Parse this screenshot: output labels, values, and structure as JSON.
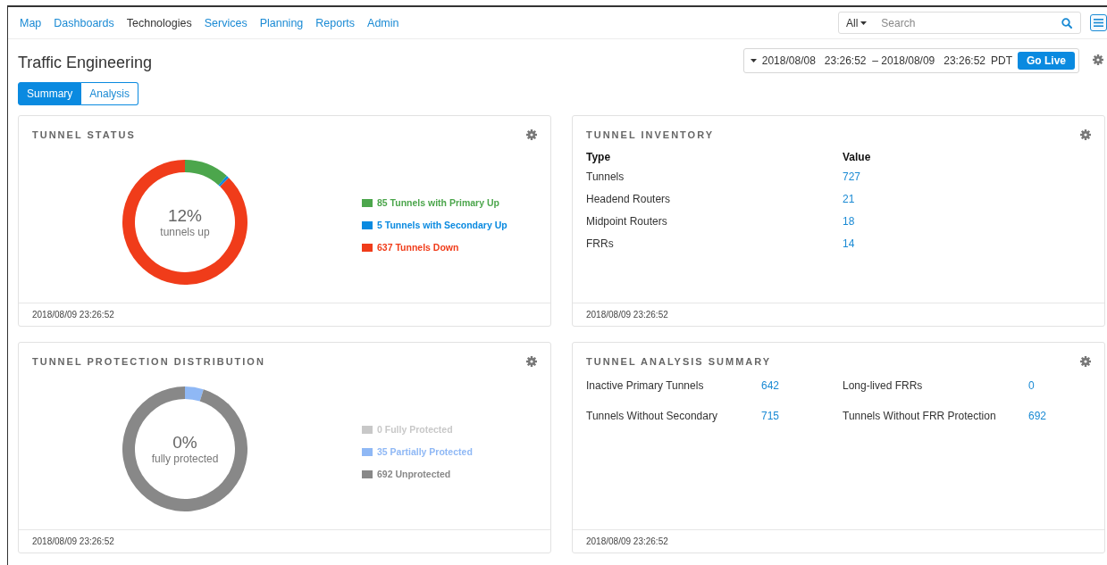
{
  "nav": {
    "items": [
      {
        "label": "Map",
        "selected": false
      },
      {
        "label": "Dashboards",
        "selected": false
      },
      {
        "label": "Technologies",
        "selected": true
      },
      {
        "label": "Services",
        "selected": false
      },
      {
        "label": "Planning",
        "selected": false
      },
      {
        "label": "Reports",
        "selected": false
      },
      {
        "label": "Admin",
        "selected": false
      }
    ],
    "scope": "All",
    "search": {
      "placeholder": "Search"
    }
  },
  "page": {
    "title": "Traffic Engineering",
    "range": "2018/08/08   23:26:52  – 2018/08/09   23:26:52",
    "timezone": "PDT",
    "live_button": "Go Live"
  },
  "tabs": [
    {
      "label": "Summary",
      "selected": true
    },
    {
      "label": "Analysis",
      "selected": false
    }
  ],
  "cards": [
    {
      "kind": "donut",
      "title": "TUNNEL STATUS",
      "center_value": "12%",
      "center_label": "tunnels up",
      "legend": [
        {
          "color": "#4ca64c"
        },
        {
          "color": "#0a8ae0"
        },
        {
          "color": "#f03c1a"
        }
      ],
      "chart_data": {
        "type": "donut",
        "categories": [
          "85 Tunnels with Primary Up",
          "5 Tunnels with Secondary Up",
          "637 Tunnels Down"
        ],
        "values": [
          85,
          5,
          637
        ]
      },
      "footer": "2018/08/09 23:26:52"
    },
    {
      "kind": "table",
      "title": "TUNNEL INVENTORY",
      "columns": [
        "Type",
        "Value"
      ],
      "rows": [
        [
          "Tunnels",
          "727"
        ],
        [
          "Headend Routers",
          "21"
        ],
        [
          "Midpoint Routers",
          "18"
        ],
        [
          "FRRs",
          "14"
        ]
      ],
      "footer": "2018/08/09 23:26:52"
    },
    {
      "kind": "donut",
      "title": "TUNNEL PROTECTION DISTRIBUTION",
      "center_value": "0%",
      "center_label": "fully protected",
      "legend": [
        {
          "color": "#c8c8c8"
        },
        {
          "color": "#8fb8f5"
        },
        {
          "color": "#888888"
        }
      ],
      "chart_data": {
        "type": "donut",
        "categories": [
          "0 Fully Protected",
          "35 Partially Protected",
          "692 Unprotected"
        ],
        "values": [
          0,
          35,
          692
        ]
      },
      "footer": "2018/08/09 23:26:52"
    },
    {
      "kind": "pairs",
      "title": "TUNNEL ANALYSIS SUMMARY",
      "items": [
        {
          "label": "Inactive Primary Tunnels",
          "value": "642"
        },
        {
          "label": "Long-lived FRRs",
          "value": "0"
        },
        {
          "label": "Tunnels Without Secondary",
          "value": "715"
        },
        {
          "label": "Tunnels Without FRR Protection",
          "value": "692"
        }
      ],
      "footer": "2018/08/09 23:26:52"
    }
  ]
}
